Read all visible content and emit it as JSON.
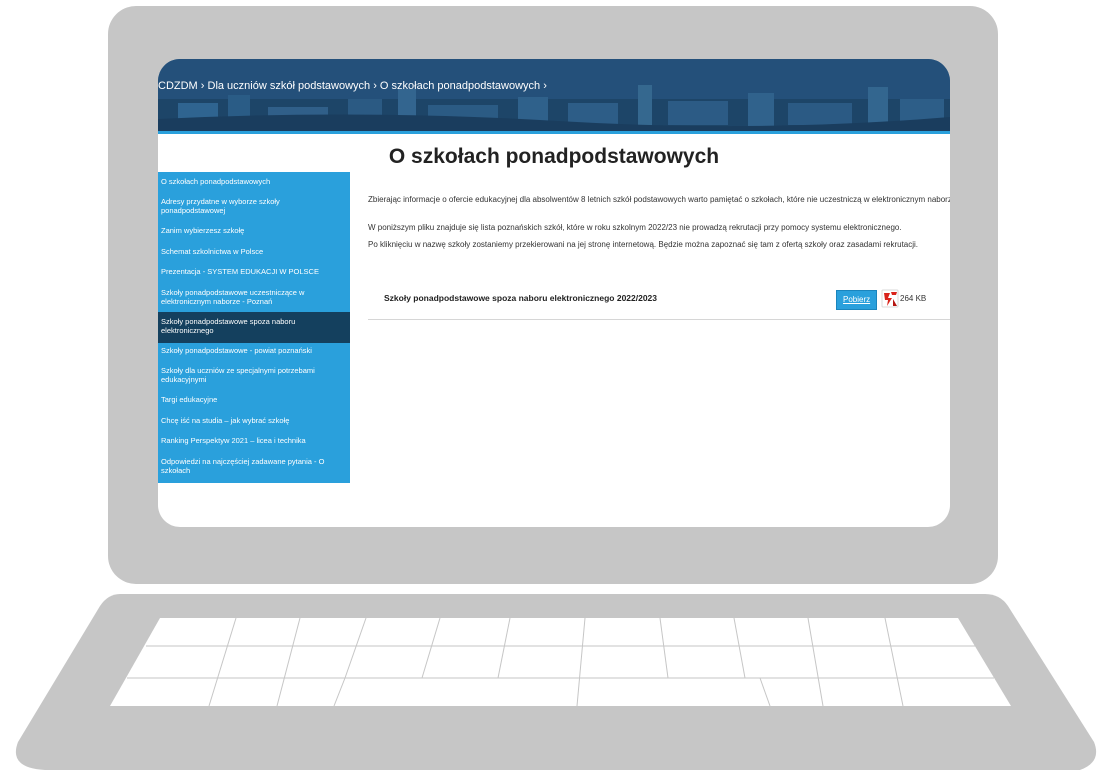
{
  "breadcrumb": {
    "item1": "CDZDM",
    "sep1": " › ",
    "item2": "Dla uczniów szkół podstawowych",
    "sep2": " › ",
    "item3": "O szkołach ponadpodstawowych",
    "sep3": " ›"
  },
  "page": {
    "title": "O szkołach ponadpodstawowych"
  },
  "sidebar": {
    "items": [
      {
        "label": "O szkołach ponadpodstawowych"
      },
      {
        "label": "Adresy przydatne w wyborze szkoły ponadpodstawowej"
      },
      {
        "label": "Zanim wybierzesz szkołę"
      },
      {
        "label": "Schemat szkolnictwa w Polsce"
      },
      {
        "label": "Prezentacja - SYSTEM EDUKACJI W POLSCE"
      },
      {
        "label": "Szkoły ponadpodstawowe uczestniczące w elektronicznym naborze - Poznań"
      },
      {
        "label": "Szkoły ponadpodstawowe spoza naboru elektronicznego"
      },
      {
        "label": "Szkoły ponadpodstawowe - powiat poznański"
      },
      {
        "label": "Szkoły dla uczniów ze specjalnymi potrzebami edukacyjnymi"
      },
      {
        "label": "Targi edukacyjne"
      },
      {
        "label": "Chcę iść na studia – jak wybrać szkołę"
      },
      {
        "label": "Ranking Perspektyw 2021 – licea i technika"
      },
      {
        "label": "Odpowiedzi na najczęściej zadawane pytania - O szkołach"
      }
    ],
    "active_index": 6
  },
  "content": {
    "paragraph1": "Zbierając informacje o ofercie edukacyjnej dla absolwentów 8 letnich szkół podstawowych warto pamiętać o szkołach, które nie uczestniczą w elektronicznym naborze.",
    "paragraph2": "W poniższym pliku znajduje się lista poznańskich szkół, które w roku szkolnym 2022/23 nie prowadzą rekrutacji przy pomocy systemu elektronicznego.",
    "paragraph3": "Po kliknięciu w nazwę szkoły zostaniemy przekierowani na jej stronę internetową. Będzie można zapoznać się tam z ofertą szkoły oraz zasadami rekrutacji."
  },
  "file": {
    "title": "Szkoły ponadpodstawowe spoza naboru elektronicznego 2022/2023",
    "download_label": "Pobierz",
    "icon": "pdf-icon",
    "size": "264 KB"
  },
  "colors": {
    "accent": "#2aa0dc",
    "active": "#14405e",
    "laptop": "#c6c6c6"
  }
}
